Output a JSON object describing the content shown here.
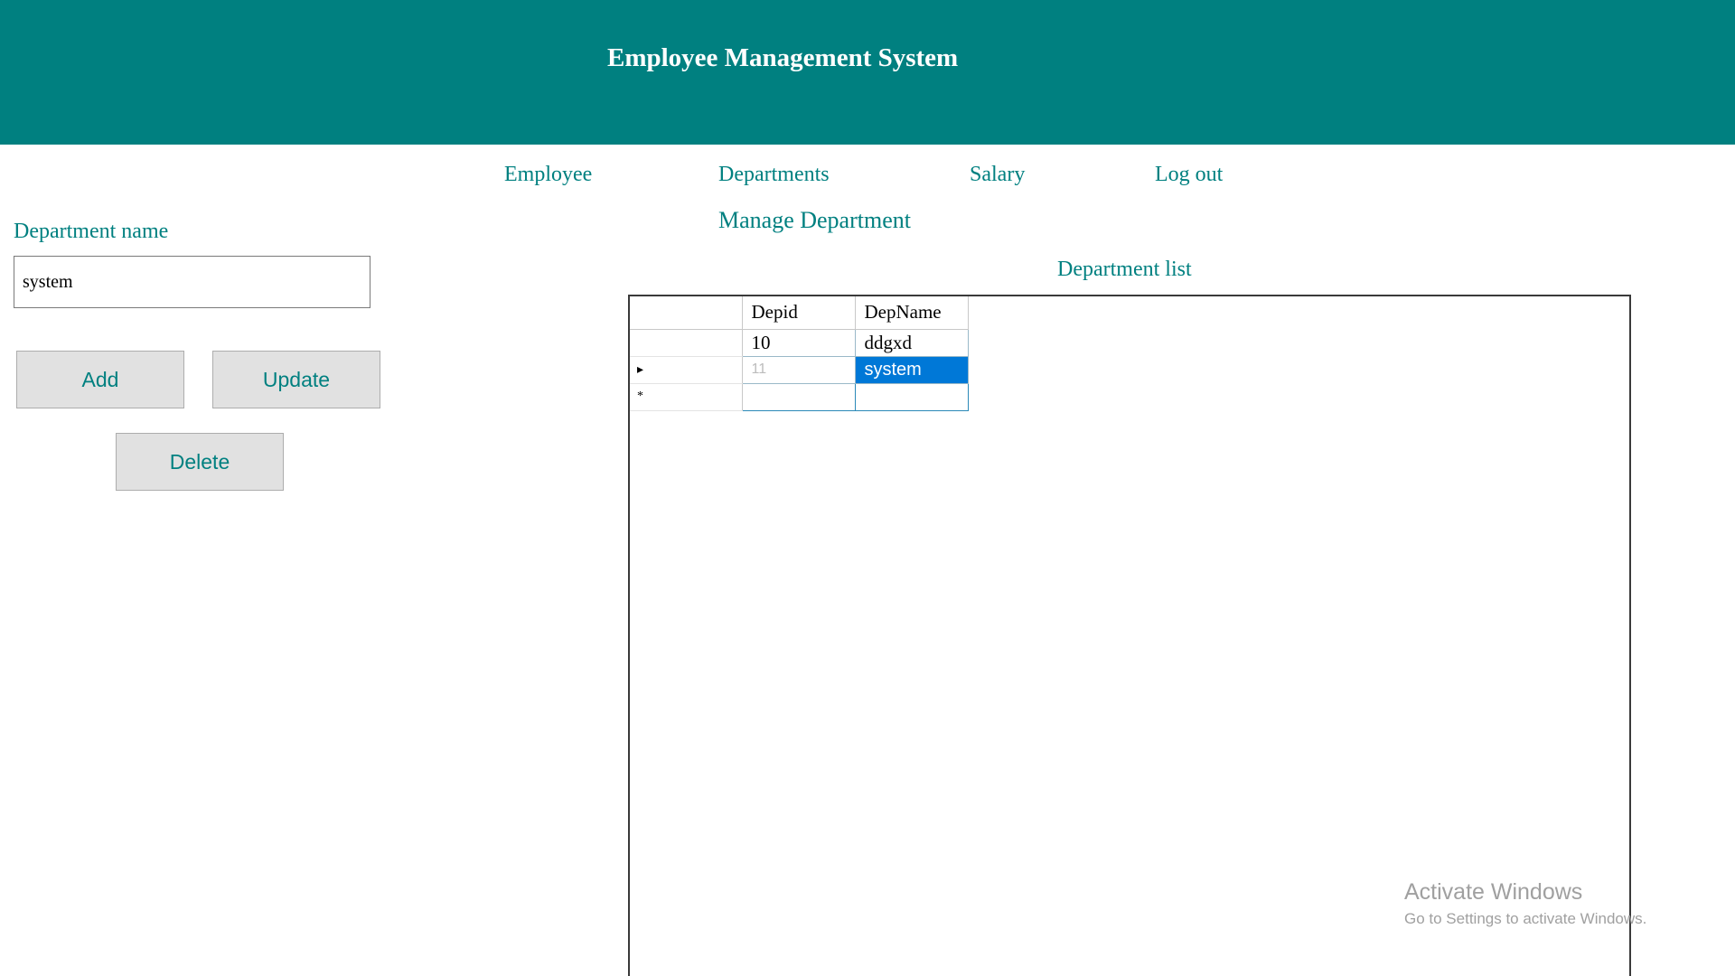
{
  "header": {
    "title": "Employee Management System",
    "bg_color": "#008080"
  },
  "nav": {
    "employee": "Employee",
    "departments": "Departments",
    "salary": "Salary",
    "logout": "Log out"
  },
  "page_title": "Manage Department",
  "form": {
    "department_label": "Department name",
    "department_value": "system",
    "add_label": "Add",
    "update_label": "Update",
    "delete_label": "Delete"
  },
  "grid": {
    "caption": "Department list",
    "columns": [
      "Depid",
      "DepName"
    ],
    "rows": [
      {
        "indicator": "",
        "depid": "10",
        "depname": "ddgxd"
      },
      {
        "indicator": "▸",
        "depid": "11",
        "depname": "system"
      },
      {
        "indicator": "*",
        "depid": "",
        "depname": ""
      }
    ],
    "selected_color": "#0078d7"
  },
  "watermark": {
    "title": "Activate Windows",
    "subtitle": "Go to Settings to activate Windows."
  }
}
